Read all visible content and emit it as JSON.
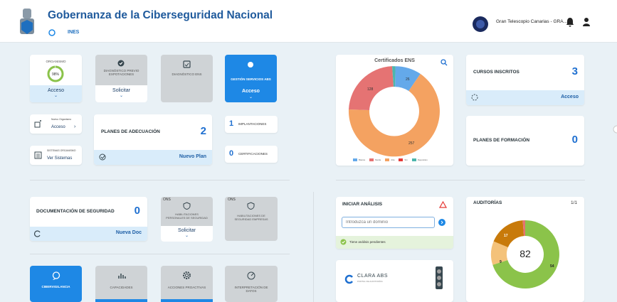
{
  "header": {
    "title": "Gobernanza de la Ciberseguridad Nacional",
    "logo_sub": "INES",
    "org": "Gran Telescopio Canarias - GRA..."
  },
  "organismo": {
    "label": "ORGANISMO",
    "percent": "98%",
    "link": "Acceso",
    "progress": 0.98
  },
  "diag_previo": {
    "label": "DIAGNÓSTICO PREVIO EXPOTACIONES",
    "link": "Solicitar"
  },
  "diag_ens": {
    "label": "DIAGNÓSTICO ENS"
  },
  "gestion": {
    "label": "GESTIÓN SERVICIOS ABS",
    "link": "Acceso"
  },
  "nuevo_org": {
    "label": "Nuevo Organismo",
    "link": "Acceso"
  },
  "sistemas": {
    "label": "SISTEMAS ORGANISMO",
    "link": "Ver Sistemas"
  },
  "planes_adec": {
    "label": "PLANES DE ADECUACIÓN",
    "count": "2",
    "link": "Nuevo Plan"
  },
  "implantaciones": {
    "count": "1",
    "label": "IMPLANTACIONES"
  },
  "certificaciones": {
    "count": "0",
    "label": "CERTIFICACIONES"
  },
  "cert_ens": {
    "title": "Certificados ENS",
    "values": [
      "26",
      "128",
      "257"
    ],
    "legend": [
      "Básica",
      "Media",
      "Alta",
      "Sin",
      "Requisitos"
    ]
  },
  "cursos": {
    "label": "CURSOS INSCRITOS",
    "count": "3",
    "link": "Acceso"
  },
  "planes_form": {
    "label": "PLANES DE FORMACIÓN",
    "count": "0"
  },
  "documentacion": {
    "label": "DOCUMENTACIÓN DE SEGURIDAD",
    "count": "0",
    "link": "Nueva Doc"
  },
  "hab_pers": {
    "label": "HABILITACIONES PERSONALES DE SEGURIDAD",
    "link": "Solicitar",
    "tag": "ONS"
  },
  "hab_emp": {
    "label": "HABILITACIONES DE SEGURIDAD EMPRESAS",
    "tag": "ONS"
  },
  "analisis": {
    "title": "INICIAR ANÁLISIS",
    "placeholder": "Introduzca un dominio",
    "status": "Tiene análisis pendientes"
  },
  "clara": {
    "title": "CLARA ABS",
    "sub": "PORTAL DE AUDITORÍAS"
  },
  "auditorias": {
    "title": "AUDITORÍAS",
    "page": "1/1",
    "total": "82",
    "values": [
      "54",
      "9",
      "17"
    ]
  },
  "bottom": {
    "vigilancia": "CIBERVIGILANCIA",
    "capacidades": "CAPACIDADES",
    "acciones": "ACCIONES PROACTIVAS",
    "interpretacion": "INTERPRETACIÓN DE DATOS"
  },
  "colors": {
    "accent": "#1e88e5",
    "title": "#1f5a9c",
    "green": "#8bc34a",
    "orange": "#f4a261",
    "red": "#e57373"
  }
}
